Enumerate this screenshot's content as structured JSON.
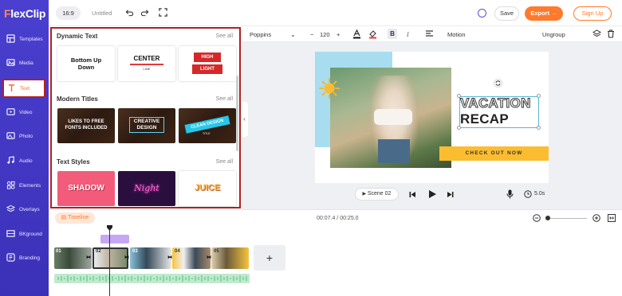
{
  "app": {
    "logo_flex": "F",
    "logo_rest": "lexClip"
  },
  "sidebar": {
    "items": [
      {
        "label": "Templates",
        "icon": "templates-icon"
      },
      {
        "label": "Media",
        "icon": "media-icon"
      },
      {
        "label": "Text",
        "icon": "text-icon",
        "active": true
      },
      {
        "label": "Video",
        "icon": "video-icon"
      },
      {
        "label": "Photo",
        "icon": "photo-icon"
      },
      {
        "label": "Audio",
        "icon": "audio-icon"
      },
      {
        "label": "Elements",
        "icon": "elements-icon"
      },
      {
        "label": "Overlays",
        "icon": "overlays-icon"
      },
      {
        "label": "BKground",
        "icon": "background-icon"
      },
      {
        "label": "Branding",
        "icon": "branding-icon"
      }
    ]
  },
  "topbar": {
    "ratio": "16:9",
    "title": "Untitled",
    "save": "Save",
    "export": "Export →",
    "signup": "Sign Up"
  },
  "panel": {
    "sections": [
      {
        "title": "Dynamic Text",
        "see_all": "See all",
        "cards": [
          {
            "line1": "Bottom Up",
            "line2": "Down"
          },
          {
            "line1": "CENTER",
            "line2": "LINE"
          },
          {
            "line1": "HIGH",
            "line2": "LIGHT"
          }
        ]
      },
      {
        "title": "Modern Titles",
        "see_all": "See all",
        "cards": [
          {
            "line1": "LIKES TO FREE",
            "line2": "FONTS INCLUDED"
          },
          {
            "line1": "CREATIVE",
            "line2": "DESIGN"
          },
          {
            "line1": "CLEAN DESIGN",
            "line2": "TITLE"
          }
        ]
      },
      {
        "title": "Text Styles",
        "see_all": "See all",
        "cards": [
          {
            "line1": "SHADOW"
          },
          {
            "line1": "Night"
          },
          {
            "line1": "JUICE"
          }
        ]
      }
    ]
  },
  "format_bar": {
    "font": "Poppins",
    "size": "120",
    "minus": "−",
    "plus": "+",
    "bold": "B",
    "italic": "I",
    "motion": "Motion",
    "ungroup": "Ungroup"
  },
  "canvas": {
    "line1": "VACATION",
    "line2": "RECAP",
    "cta": "CHECK OUT NOW",
    "colors": {
      "accent_blue": "#a8ddef",
      "cta_yellow": "#fbbd30"
    }
  },
  "playback": {
    "scene": "Scene",
    "scene_number": "02",
    "duration": "5.0s"
  },
  "timeline": {
    "label": "Timeline",
    "timecode": "00:07.4 / 00:25.0",
    "zoom_level": 0,
    "clips": [
      "01",
      "02",
      "03",
      "04",
      "05"
    ],
    "add": "+"
  },
  "colors": {
    "brand_purple": "#4a3fcf",
    "brand_orange": "#ff7a2d",
    "highlight_red": "#b02020"
  }
}
